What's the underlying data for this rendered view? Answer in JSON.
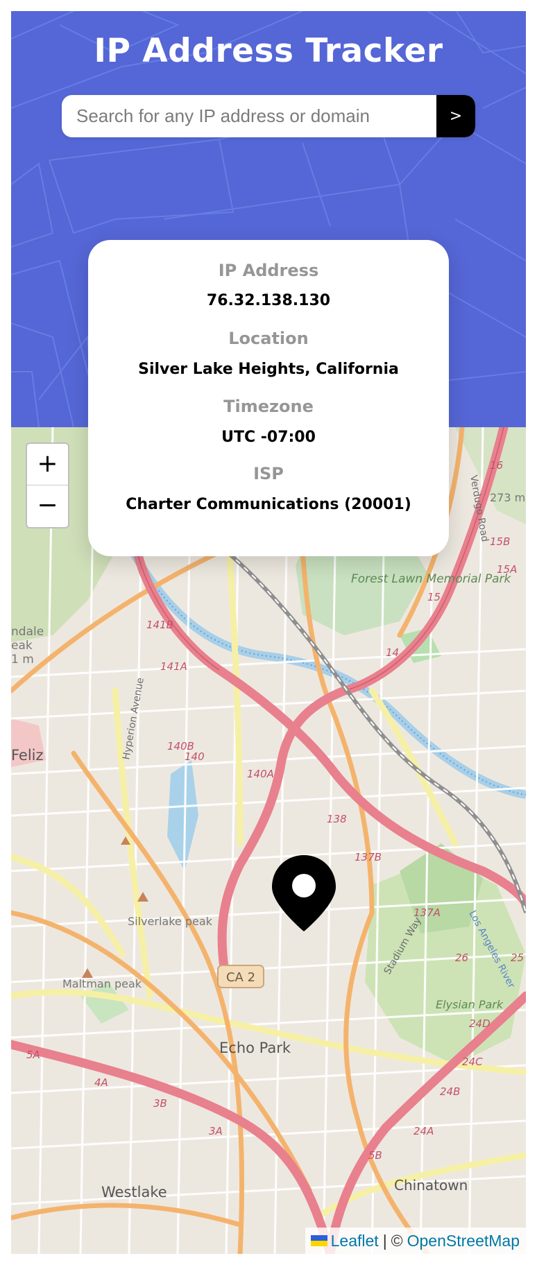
{
  "header": {
    "title": "IP Address Tracker",
    "background_color": "#5566d6"
  },
  "search": {
    "placeholder": "Search for any IP address or domain",
    "value": "",
    "submit_label": ">"
  },
  "info": {
    "ip_label": "IP Address",
    "ip_value": "76.32.138.130",
    "location_label": "Location",
    "location_value": "Silver Lake Heights, California",
    "timezone_label": "Timezone",
    "timezone_value": "UTC -07:00",
    "isp_label": "ISP",
    "isp_value": "Charter Communications (20001)"
  },
  "map": {
    "zoom_in_label": "+",
    "zoom_out_label": "−",
    "marker_icon": "location-pin-icon",
    "attribution": {
      "leaflet": "Leaflet",
      "separator": "|",
      "copyright": "©",
      "osm": "OpenStreetMap"
    },
    "places": {
      "forest_lawn": "Forest Lawn Memorial Park",
      "feliz": "Feliz",
      "silverlake_peak": "Silverlake peak",
      "maltman_peak": "Maltman peak",
      "echo_park": "Echo Park",
      "westlake": "Westlake",
      "chinatown": "Chinatown",
      "elysian_park": "Elysian Park",
      "hyperion": "Hyperion Avenue",
      "verdugo": "Verdugo Road",
      "stadium_way": "Stadium Way",
      "la_river": "Los Angeles River",
      "ca2": "CA 2",
      "dale": "ndale",
      "eak": "eak",
      "m1": "1 m",
      "m273": "273 m"
    },
    "road_labels": [
      "16",
      "15B",
      "15A",
      "15",
      "14",
      "140B",
      "141B",
      "141A",
      "140",
      "140A",
      "138",
      "137B",
      "137A",
      "26",
      "25",
      "24D",
      "24C",
      "24B",
      "24A",
      "5B",
      "5A",
      "4A",
      "3B",
      "3A"
    ]
  }
}
